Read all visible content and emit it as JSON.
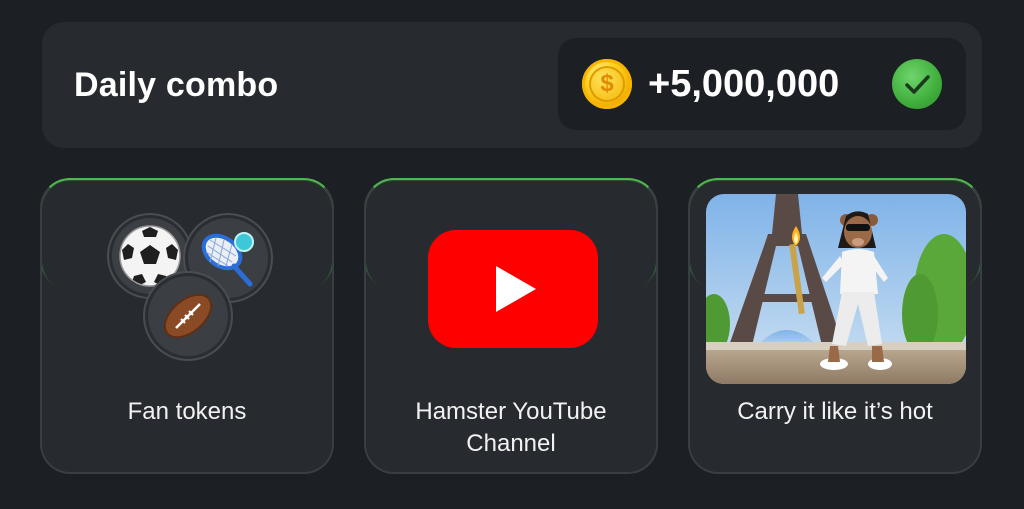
{
  "header": {
    "title": "Daily combo",
    "reward_amount": "+5,000,000",
    "coin_symbol": "$",
    "status": "claimed"
  },
  "cards": [
    {
      "label": "Fan tokens",
      "icon": "sports-balls-icon"
    },
    {
      "label": "Hamster YouTube Channel",
      "icon": "youtube-icon"
    },
    {
      "label": "Carry it like it’s hot",
      "icon": "torch-hamster-paris-image"
    }
  ],
  "colors": {
    "background": "#1c1f24",
    "panel": "#272a2f",
    "accent_green": "#4fb84c",
    "coin_gold": "#f4b400",
    "youtube_red": "#ff0000"
  }
}
